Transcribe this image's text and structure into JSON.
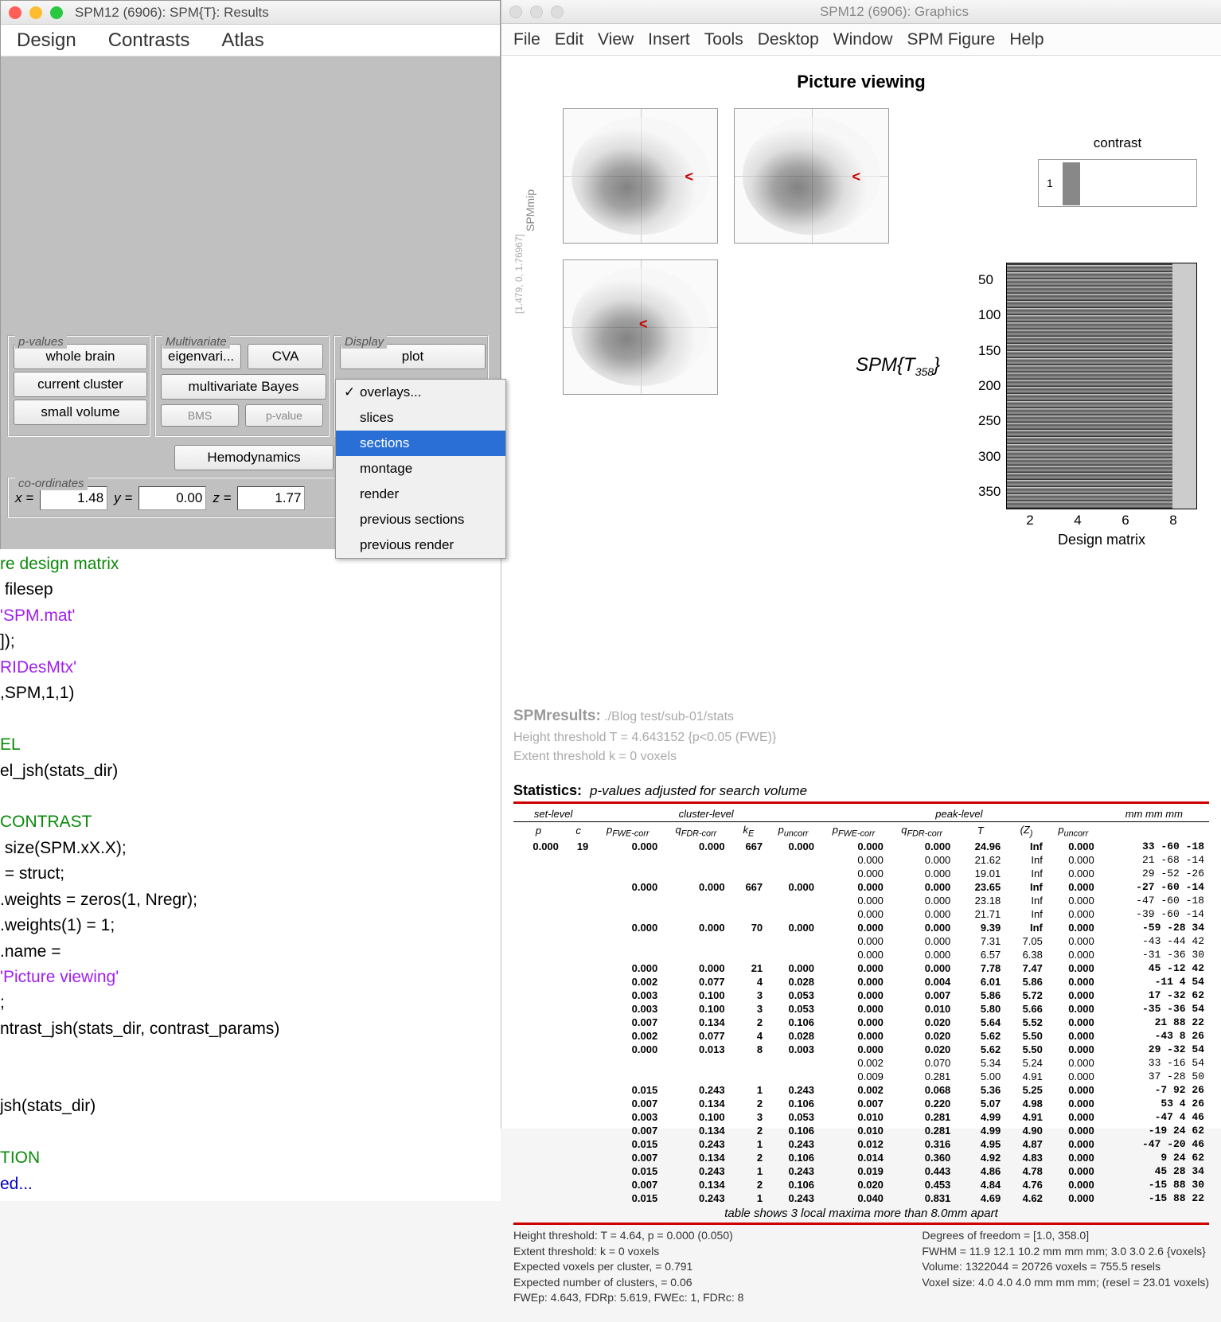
{
  "results_window": {
    "title": "SPM12 (6906): SPM{T}: Results",
    "menus": [
      "Design",
      "Contrasts",
      "Atlas"
    ],
    "panels": {
      "pvalues": {
        "label": "p-values",
        "buttons": [
          "whole brain",
          "current cluster",
          "small volume"
        ]
      },
      "multivariate": {
        "label": "Multivariate",
        "row1": [
          "eigenvari...",
          "CVA"
        ],
        "row2": "multivariate Bayes",
        "row3": [
          "BMS",
          "p-value"
        ]
      },
      "display": {
        "label": "Display",
        "button": "plot"
      },
      "hemo": "Hemodynamics",
      "coords": {
        "label": "co-ordinates",
        "x": "1.48",
        "y": "0.00",
        "z": "1.77"
      }
    },
    "dropdown": {
      "items": [
        "overlays...",
        "slices",
        "sections",
        "montage",
        "render",
        "previous sections",
        "previous render"
      ],
      "checked": 0,
      "selected": 2
    }
  },
  "code_lines": [
    {
      "t": "re design matrix",
      "c": "cg"
    },
    {
      "t": " filesep ",
      "c": ""
    },
    {
      "t2": "'SPM.mat'",
      "c2": "cp"
    },
    {
      "t3": "]);",
      "c3": ""
    },
    {
      "t": "RIDesMtx'",
      "c": "cp"
    },
    {
      "t2": ",SPM,1,1)",
      "c2": ""
    },
    {
      "t": "",
      "c": ""
    },
    {
      "t": "EL",
      "c": "cg"
    },
    {
      "t": "el_jsh(stats_dir)",
      "c": ""
    },
    {
      "t": "",
      "c": ""
    },
    {
      "t": "CONTRAST",
      "c": "cg"
    },
    {
      "t": " size(SPM.xX.X);",
      "c": ""
    },
    {
      "t": " = struct;",
      "c": ""
    },
    {
      "t": ".weights = zeros(1, Nregr);",
      "c": ""
    },
    {
      "t": ".weights(1) = 1;",
      "c": ""
    },
    {
      "t": ".name = ",
      "c": ""
    },
    {
      "t2": "'Picture viewing'",
      "c2": "cp"
    },
    {
      "t3": ";",
      "c3": ""
    },
    {
      "t": "ntrast_jsh(stats_dir, contrast_params)",
      "c": ""
    },
    {
      "t": "",
      "c": ""
    },
    {
      "t": "",
      "c": ""
    },
    {
      "t": "jsh(stats_dir)",
      "c": ""
    },
    {
      "t": "",
      "c": ""
    },
    {
      "t": "TION",
      "c": "cg"
    },
    {
      "t": "ed...",
      "c": "cb"
    }
  ],
  "graphics_window": {
    "title": "SPM12 (6906): Graphics",
    "menus": [
      "File",
      "Edit",
      "View",
      "Insert",
      "Tools",
      "Desktop",
      "Window",
      "SPM Figure",
      "Help"
    ],
    "fig_title": "Picture viewing",
    "mip_label": "SPMmip",
    "mip_coords": "[1.479, 0, 1.76967]",
    "spm_t": "SPM{T",
    "spm_t_sub": "358",
    "spm_t_end": "}",
    "contrast_label": "contrast",
    "dm_label": "Design matrix",
    "dm_yticks": [
      "50",
      "100",
      "150",
      "200",
      "250",
      "300",
      "350"
    ],
    "dm_xticks": [
      "2",
      "4",
      "6",
      "8"
    ],
    "results_text": {
      "head": "SPMresults:",
      "path": "./Blog test/sub-01/stats",
      "l1": "Height threshold T = 4.643152  {p<0.05 (FWE)}",
      "l2": "Extent threshold k = 0 voxels"
    }
  },
  "stats": {
    "title": "Statistics:",
    "subtitle": "p-values adjusted for search volume",
    "groups": [
      "set-level",
      "cluster-level",
      "peak-level",
      "mm mm mm"
    ],
    "headers": [
      "p",
      "c",
      "p_FWE-corr",
      "q_FDR-corr",
      "k_E",
      "p_uncorr",
      "p_FWE-corr",
      "q_FDR-corr",
      "T",
      "(Z_)",
      "p_uncorr",
      ""
    ],
    "rows": [
      {
        "b": 1,
        "d": [
          "0.000",
          "19",
          "0.000",
          "0.000",
          "667",
          "0.000",
          "0.000",
          "0.000",
          "24.96",
          "Inf",
          "0.000",
          "33 -60 -18"
        ]
      },
      {
        "b": 0,
        "d": [
          "",
          "",
          "",
          "",
          "",
          "",
          "0.000",
          "0.000",
          "21.62",
          "Inf",
          "0.000",
          "21 -68 -14"
        ]
      },
      {
        "b": 0,
        "d": [
          "",
          "",
          "",
          "",
          "",
          "",
          "0.000",
          "0.000",
          "19.01",
          "Inf",
          "0.000",
          "29 -52 -26"
        ]
      },
      {
        "b": 1,
        "d": [
          "",
          "",
          "0.000",
          "0.000",
          "667",
          "0.000",
          "0.000",
          "0.000",
          "23.65",
          "Inf",
          "0.000",
          "-27 -60 -14"
        ]
      },
      {
        "b": 0,
        "d": [
          "",
          "",
          "",
          "",
          "",
          "",
          "0.000",
          "0.000",
          "23.18",
          "Inf",
          "0.000",
          "-47 -60 -18"
        ]
      },
      {
        "b": 0,
        "d": [
          "",
          "",
          "",
          "",
          "",
          "",
          "0.000",
          "0.000",
          "21.71",
          "Inf",
          "0.000",
          "-39 -60 -14"
        ]
      },
      {
        "b": 1,
        "d": [
          "",
          "",
          "0.000",
          "0.000",
          "70",
          "0.000",
          "0.000",
          "0.000",
          "9.39",
          "Inf",
          "0.000",
          "-59 -28  34"
        ]
      },
      {
        "b": 0,
        "d": [
          "",
          "",
          "",
          "",
          "",
          "",
          "0.000",
          "0.000",
          "7.31",
          "7.05",
          "0.000",
          "-43 -44  42"
        ]
      },
      {
        "b": 0,
        "d": [
          "",
          "",
          "",
          "",
          "",
          "",
          "0.000",
          "0.000",
          "6.57",
          "6.38",
          "0.000",
          "-31 -36  30"
        ]
      },
      {
        "b": 1,
        "d": [
          "",
          "",
          "0.000",
          "0.000",
          "21",
          "0.000",
          "0.000",
          "0.000",
          "7.78",
          "7.47",
          "0.000",
          "45 -12  42"
        ]
      },
      {
        "b": 1,
        "d": [
          "",
          "",
          "0.002",
          "0.077",
          "4",
          "0.028",
          "0.000",
          "0.004",
          "6.01",
          "5.86",
          "0.000",
          "-11   4  54"
        ]
      },
      {
        "b": 1,
        "d": [
          "",
          "",
          "0.003",
          "0.100",
          "3",
          "0.053",
          "0.000",
          "0.007",
          "5.86",
          "5.72",
          "0.000",
          "17 -32  62"
        ]
      },
      {
        "b": 1,
        "d": [
          "",
          "",
          "0.003",
          "0.100",
          "3",
          "0.053",
          "0.000",
          "0.010",
          "5.80",
          "5.66",
          "0.000",
          "-35 -36  54"
        ]
      },
      {
        "b": 1,
        "d": [
          "",
          "",
          "0.007",
          "0.134",
          "2",
          "0.106",
          "0.000",
          "0.020",
          "5.64",
          "5.52",
          "0.000",
          "21  88  22"
        ]
      },
      {
        "b": 1,
        "d": [
          "",
          "",
          "0.002",
          "0.077",
          "4",
          "0.028",
          "0.000",
          "0.020",
          "5.62",
          "5.50",
          "0.000",
          "-43   8  26"
        ]
      },
      {
        "b": 1,
        "d": [
          "",
          "",
          "0.000",
          "0.013",
          "8",
          "0.003",
          "0.000",
          "0.020",
          "5.62",
          "5.50",
          "0.000",
          "29 -32  54"
        ]
      },
      {
        "b": 0,
        "d": [
          "",
          "",
          "",
          "",
          "",
          "",
          "0.002",
          "0.070",
          "5.34",
          "5.24",
          "0.000",
          "33 -16  54"
        ]
      },
      {
        "b": 0,
        "d": [
          "",
          "",
          "",
          "",
          "",
          "",
          "0.009",
          "0.281",
          "5.00",
          "4.91",
          "0.000",
          "37 -28  50"
        ]
      },
      {
        "b": 1,
        "d": [
          "",
          "",
          "0.015",
          "0.243",
          "1",
          "0.243",
          "0.002",
          "0.068",
          "5.36",
          "5.25",
          "0.000",
          "-7  92  26"
        ]
      },
      {
        "b": 1,
        "d": [
          "",
          "",
          "0.007",
          "0.134",
          "2",
          "0.106",
          "0.007",
          "0.220",
          "5.07",
          "4.98",
          "0.000",
          "53   4  26"
        ]
      },
      {
        "b": 1,
        "d": [
          "",
          "",
          "0.003",
          "0.100",
          "3",
          "0.053",
          "0.010",
          "0.281",
          "4.99",
          "4.91",
          "0.000",
          "-47   4  46"
        ]
      },
      {
        "b": 1,
        "d": [
          "",
          "",
          "0.007",
          "0.134",
          "2",
          "0.106",
          "0.010",
          "0.281",
          "4.99",
          "4.90",
          "0.000",
          "-19  24  62"
        ]
      },
      {
        "b": 1,
        "d": [
          "",
          "",
          "0.015",
          "0.243",
          "1",
          "0.243",
          "0.012",
          "0.316",
          "4.95",
          "4.87",
          "0.000",
          "-47 -20  46"
        ]
      },
      {
        "b": 1,
        "d": [
          "",
          "",
          "0.007",
          "0.134",
          "2",
          "0.106",
          "0.014",
          "0.360",
          "4.92",
          "4.83",
          "0.000",
          "9  24  62"
        ]
      },
      {
        "b": 1,
        "d": [
          "",
          "",
          "0.015",
          "0.243",
          "1",
          "0.243",
          "0.019",
          "0.443",
          "4.86",
          "4.78",
          "0.000",
          "45  28  34"
        ]
      },
      {
        "b": 1,
        "d": [
          "",
          "",
          "0.007",
          "0.134",
          "2",
          "0.106",
          "0.020",
          "0.453",
          "4.84",
          "4.76",
          "0.000",
          "-15  88  30"
        ]
      },
      {
        "b": 1,
        "d": [
          "",
          "",
          "0.015",
          "0.243",
          "1",
          "0.243",
          "0.040",
          "0.831",
          "4.69",
          "4.62",
          "0.000",
          "-15  88  22"
        ]
      }
    ],
    "note": "table shows 3 local maxima more than 8.0mm apart",
    "footer": {
      "left": [
        "Height threshold: T = 4.64, p = 0.000 (0.050)",
        "Extent threshold: k = 0 voxels",
        "Expected voxels per cluster, <k> = 0.791",
        "Expected number of clusters, <c> = 0.06",
        "FWEp: 4.643, FDRp: 5.619, FWEc: 1, FDRc: 8"
      ],
      "right": [
        "Degrees of freedom = [1.0, 358.0]",
        "FWHM = 11.9 12.1 10.2 mm mm mm; 3.0 3.0 2.6 {voxels}",
        "Volume: 1322044 = 20726 voxels = 755.5 resels",
        "Voxel size: 4.0 4.0 4.0 mm mm mm; (resel = 23.01 voxels)"
      ]
    }
  }
}
